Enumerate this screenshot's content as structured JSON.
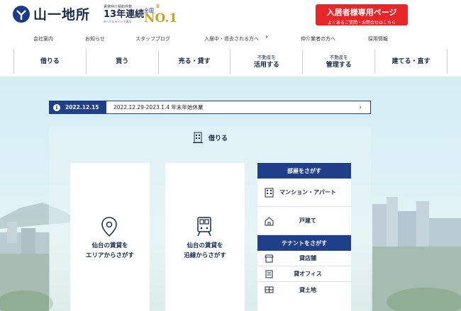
{
  "header": {
    "logo_text": "山一地所",
    "award_small": "賃貸仲介契約件数",
    "award_big": "13年連続",
    "award_tiny": "※ハウスメイトで表示",
    "no1_label": "全国",
    "no1_big": "NO.1",
    "resident_title": "入居者様専用ページ",
    "resident_sub": "よくあるご質問・お問合せはこちら"
  },
  "subnav": {
    "items": [
      "会社案内",
      "お知らせ",
      "スタッフブログ",
      "入居中・退去される方へ",
      "仲介業者の方へ",
      "採用情報"
    ]
  },
  "mainnav": {
    "items": [
      {
        "small": "",
        "label": "借りる"
      },
      {
        "small": "",
        "label": "買う"
      },
      {
        "small": "",
        "label": "売る・貸す"
      },
      {
        "small": "不動産を",
        "label": "活用する"
      },
      {
        "small": "不動産を",
        "label": "管理する"
      },
      {
        "small": "",
        "label": "建てる・直す"
      }
    ]
  },
  "notice": {
    "date": "2022.12.15",
    "text": "2022.12.29-2023.1.4 年末年始休業"
  },
  "section": {
    "title": "借りる"
  },
  "cards": [
    {
      "line1": "仙台の賃貸を",
      "line2": "エリアからさがす"
    },
    {
      "line1": "仙台の賃貸を",
      "line2": "沿線からさがす"
    }
  ],
  "side": {
    "room_head": "部屋をさがす",
    "room_items": [
      "マンション・アパート",
      "戸建て"
    ],
    "tenant_head": "テナントをさがす",
    "tenant_items": [
      "貸店舗",
      "貸オフィス",
      "貸土地"
    ]
  },
  "colors": {
    "brand_navy": "#1f3f8a",
    "resident_red": "#e8262a",
    "gold": "#c9a227"
  }
}
